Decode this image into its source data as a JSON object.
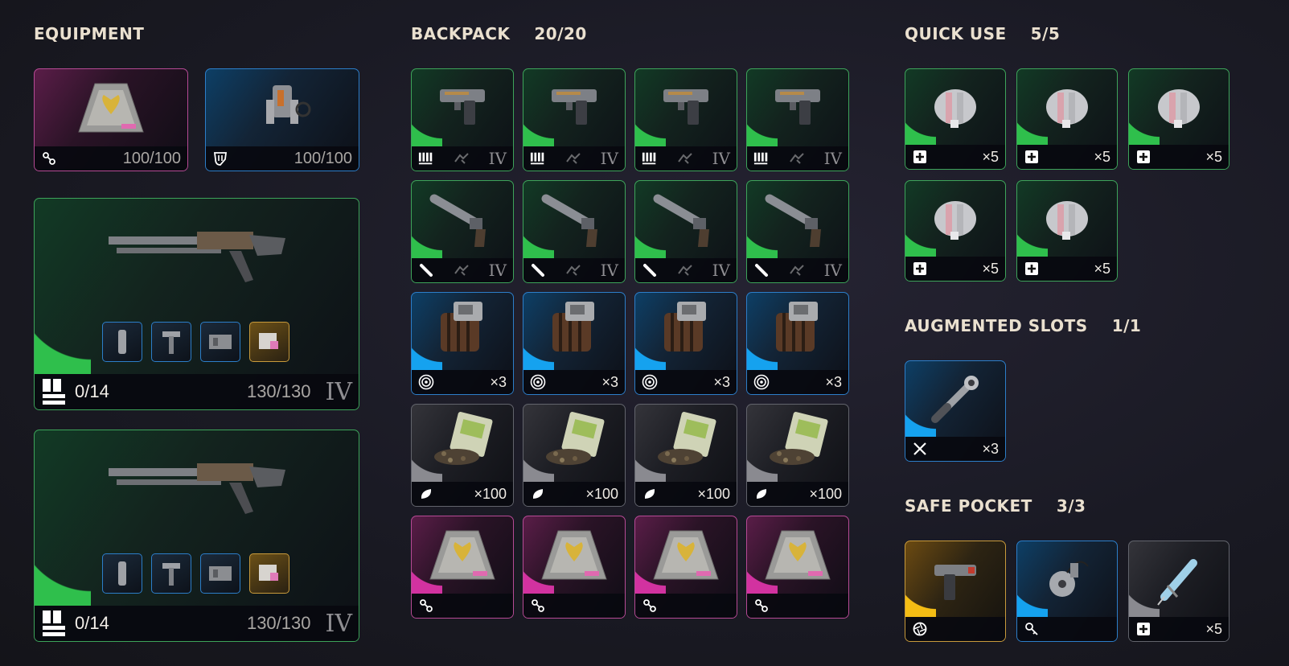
{
  "equipment": {
    "heading": "EQUIPMENT",
    "augment": {
      "durability": "100/100",
      "icon": "augment-icon",
      "rarity_color": "#d232a0"
    },
    "shield": {
      "durability": "100/100",
      "icon": "shield-icon",
      "rarity_color": "#15a2ef"
    },
    "weapons": [
      {
        "ammo": "0/14",
        "durability": "130/130",
        "tier": "IV",
        "icon": "ammo-icon"
      },
      {
        "ammo": "0/14",
        "durability": "130/130",
        "tier": "IV",
        "icon": "ammo-icon"
      }
    ]
  },
  "backpack": {
    "heading": "BACKPACK",
    "capacity": "20/20",
    "rows": [
      {
        "kind": "pistol",
        "rarity": "green",
        "left_icon": "ammo-light-icon",
        "tier": "IV",
        "qty": ""
      },
      {
        "kind": "revolver",
        "rarity": "green",
        "left_icon": "ammo-pencil-icon",
        "tier": "IV",
        "qty": ""
      },
      {
        "kind": "mine",
        "rarity": "blue",
        "left_icon": "target-icon",
        "tier": "",
        "qty": "×3"
      },
      {
        "kind": "seeds",
        "rarity": "grey",
        "left_icon": "leaf-icon",
        "tier": "",
        "qty": "×100"
      },
      {
        "kind": "augment",
        "rarity": "pink",
        "left_icon": "augment-icon",
        "tier": "",
        "qty": ""
      }
    ]
  },
  "quick_use": {
    "heading": "QUICK USE",
    "capacity": "5/5",
    "items": [
      {
        "qty": "×5",
        "icon": "medkit-icon"
      },
      {
        "qty": "×5",
        "icon": "medkit-icon"
      },
      {
        "qty": "×5",
        "icon": "medkit-icon"
      },
      {
        "qty": "×5",
        "icon": "medkit-icon"
      },
      {
        "qty": "×5",
        "icon": "medkit-icon"
      }
    ]
  },
  "augmented_slots": {
    "heading": "AUGMENTED SLOTS",
    "capacity": "1/1",
    "items": [
      {
        "qty": "×3",
        "icon": "tools-icon"
      }
    ]
  },
  "safe_pocket": {
    "heading": "SAFE POCKET",
    "capacity": "3/3",
    "items": [
      {
        "qty": "",
        "icon": "shutter-icon",
        "rarity": "gold"
      },
      {
        "qty": "",
        "icon": "key-icon",
        "rarity": "blue"
      },
      {
        "qty": "×5",
        "icon": "medkit-icon",
        "rarity": "grey"
      }
    ]
  }
}
